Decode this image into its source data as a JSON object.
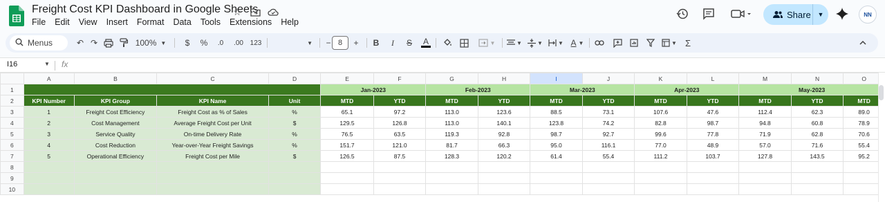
{
  "app": {
    "title": "Freight Cost KPI Dashboard in Google Sheets"
  },
  "menu": [
    "File",
    "Edit",
    "View",
    "Insert",
    "Format",
    "Data",
    "Tools",
    "Extensions",
    "Help"
  ],
  "share": {
    "label": "Share"
  },
  "avatar": {
    "initials": "NN"
  },
  "toolbar": {
    "menus_label": "Menus",
    "zoom": "100%",
    "currency": "$",
    "percent": "%",
    "dec_decrease": ".0",
    "dec_increase": ".00",
    "number_format": "123",
    "font_size": "8",
    "minus": "−",
    "plus": "+",
    "bold": "B",
    "italic": "I",
    "font_color": "A",
    "text_color": "A",
    "sum": "Σ"
  },
  "formula_bar": {
    "cell_ref": "I16",
    "fx": "fx"
  },
  "columns": [
    "A",
    "B",
    "C",
    "D",
    "E",
    "F",
    "G",
    "H",
    "I",
    "J",
    "K",
    "L",
    "M",
    "N",
    "O"
  ],
  "rows": [
    "1",
    "2",
    "3",
    "4",
    "5",
    "6",
    "7",
    "8",
    "9",
    "10"
  ],
  "months": [
    "Jan-2023",
    "Feb-2023",
    "Mar-2023",
    "Apr-2023",
    "May-2023"
  ],
  "headers": {
    "kpi_number": "KPI Number",
    "kpi_group": "KPI Group",
    "kpi_name": "KPI Name",
    "unit": "Unit",
    "mtd": "MTD",
    "ytd": "YTD"
  },
  "kpis": [
    {
      "num": "1",
      "group": "Freight Cost Efficiency",
      "name": "Freight Cost as % of Sales",
      "unit": "%",
      "values": [
        "65.1",
        "97.2",
        "113.0",
        "123.6",
        "88.5",
        "73.1",
        "107.6",
        "47.6",
        "112.4",
        "62.3",
        "89.0"
      ]
    },
    {
      "num": "2",
      "group": "Cost Management",
      "name": "Average Freight Cost per Unit",
      "unit": "$",
      "values": [
        "129.5",
        "126.8",
        "113.0",
        "140.1",
        "123.8",
        "74.2",
        "82.8",
        "98.7",
        "94.8",
        "60.8",
        "78.9"
      ]
    },
    {
      "num": "3",
      "group": "Service Quality",
      "name": "On-time Delivery Rate",
      "unit": "%",
      "values": [
        "76.5",
        "63.5",
        "119.3",
        "92.8",
        "98.7",
        "92.7",
        "99.6",
        "77.8",
        "71.9",
        "62.8",
        "70.6"
      ]
    },
    {
      "num": "4",
      "group": "Cost Reduction",
      "name": "Year-over-Year Freight Savings",
      "unit": "%",
      "values": [
        "151.7",
        "121.0",
        "81.7",
        "66.3",
        "95.0",
        "116.1",
        "77.0",
        "48.9",
        "57.0",
        "71.6",
        "55.4"
      ]
    },
    {
      "num": "5",
      "group": "Operational Efficiency",
      "name": "Freight Cost per Mile",
      "unit": "$",
      "values": [
        "126.5",
        "87.5",
        "128.3",
        "120.2",
        "61.4",
        "55.4",
        "111.2",
        "103.7",
        "127.8",
        "143.5",
        "95.2"
      ]
    }
  ],
  "colors": {
    "band": "#3b7a1f",
    "month_header": "#b6e4a2",
    "sub_header": "#38761d",
    "kpi_fill": "#d9ead3",
    "share": "#c2e7ff"
  }
}
